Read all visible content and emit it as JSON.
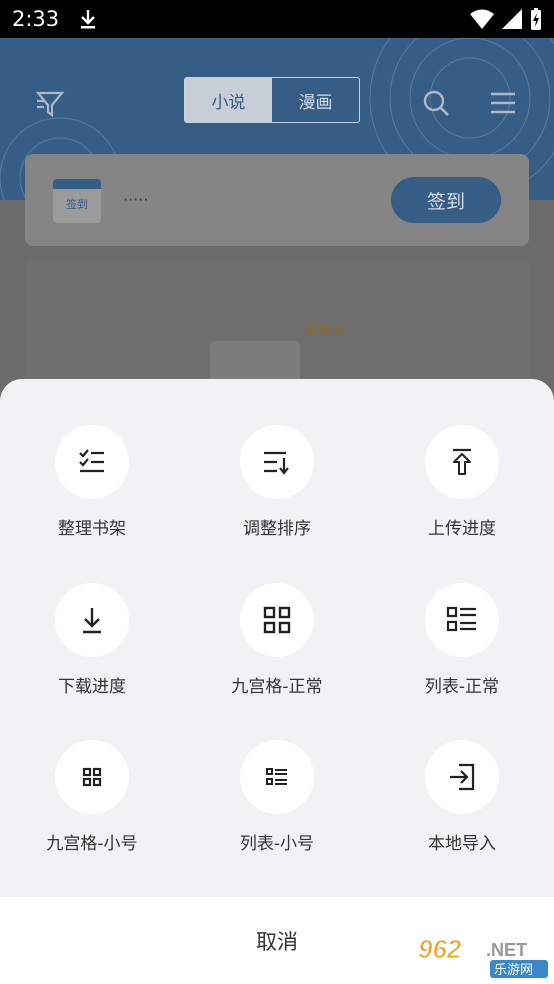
{
  "status": {
    "time": "2:33"
  },
  "header": {
    "tabs": [
      {
        "label": "小说",
        "active": true
      },
      {
        "label": "漫画",
        "active": false
      }
    ]
  },
  "signin": {
    "calendar_label": "签到",
    "text": "·····",
    "button_label": "签到"
  },
  "empty_shelf": {
    "text": "没书啦~"
  },
  "sheet": {
    "items": [
      {
        "label": "整理书架",
        "icon": "checklist-icon"
      },
      {
        "label": "调整排序",
        "icon": "sort-icon"
      },
      {
        "label": "上传进度",
        "icon": "upload-icon"
      },
      {
        "label": "下载进度",
        "icon": "download-icon"
      },
      {
        "label": "九宫格-正常",
        "icon": "grid-icon"
      },
      {
        "label": "列表-正常",
        "icon": "list-icon"
      },
      {
        "label": "九宫格-小号",
        "icon": "grid-small-icon"
      },
      {
        "label": "列表-小号",
        "icon": "list-small-icon"
      },
      {
        "label": "本地导入",
        "icon": "import-icon"
      }
    ],
    "cancel_label": "取消"
  },
  "watermark": {
    "number": "962",
    "suffix": ".NET",
    "cn": "乐游网"
  },
  "colors": {
    "accent": "#4a7fc1",
    "sheet_bg": "#f2f2f4"
  }
}
